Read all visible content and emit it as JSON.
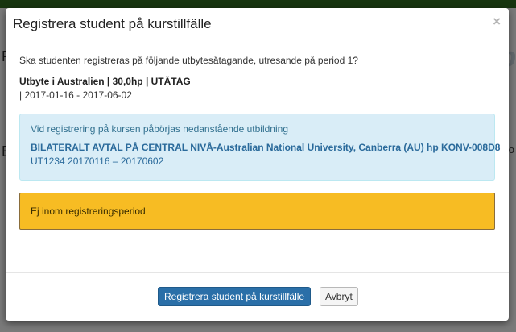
{
  "modal": {
    "title": "Registrera student på kurstillfälle",
    "close_label": "×",
    "question": "Ska studenten registreras på följande utbytesåtagande, utresande på period 1?",
    "exchange_title": "Utbyte i Australien | 30,0hp | UTÄTAG",
    "exchange_dates": "| 2017-01-16 - 2017-06-02",
    "info": {
      "intro": "Vid registrering på kursen påbörjas nedanstående utbildning",
      "program_link": "BILATERALT AVTAL PÅ CENTRAL NIVÅ-Australian National University, Canberra (AU) hp KONV-008D8",
      "program_instance": "UT1234 20170116 – 20170602"
    },
    "warning": "Ej inom registreringsperiod",
    "footer": {
      "register_button": "Registrera student på kurstillfälle",
      "cancel_button": "Avbryt"
    }
  },
  "colors": {
    "primary": "#2a6fa8",
    "info_bg": "#d9edf7",
    "warning_bg": "#f7bc23",
    "nav_bg": "#2f6b1f"
  }
}
